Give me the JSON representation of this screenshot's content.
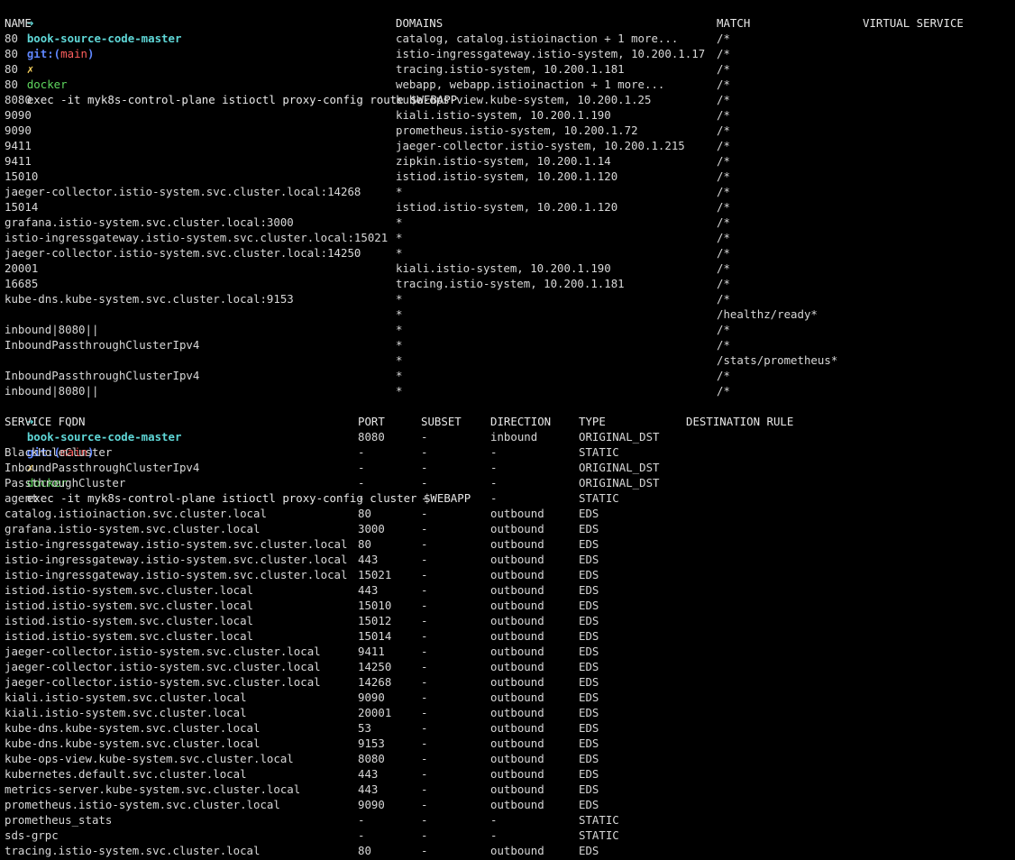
{
  "colors": {
    "background": "#000000",
    "text": "#d8d8d8",
    "prompt_cyan": "#5fd7d7",
    "git_blue": "#5f87ff",
    "branch_red": "#ff5f5f",
    "dirty_yellow": "#ffd75f",
    "command_green": "#5fd75f"
  },
  "prompt": {
    "arrow": "➜",
    "dir": "book-source-code-master",
    "git_label": "git:(",
    "branch": "main",
    "git_close": ")",
    "dirty": "✗"
  },
  "route_cmd": {
    "name": "docker",
    "args": "exec -it myk8s-control-plane istioctl proxy-config route $WEBAPP"
  },
  "route_table": {
    "headers": [
      "NAME",
      "DOMAINS",
      "MATCH",
      "VIRTUAL SERVICE"
    ],
    "rows": [
      [
        "80",
        "catalog, catalog.istioinaction + 1 more...",
        "/*",
        ""
      ],
      [
        "80",
        "istio-ingressgateway.istio-system, 10.200.1.17",
        "/*",
        ""
      ],
      [
        "80",
        "tracing.istio-system, 10.200.1.181",
        "/*",
        ""
      ],
      [
        "80",
        "webapp, webapp.istioinaction + 1 more...",
        "/*",
        ""
      ],
      [
        "8080",
        "kube-ops-view.kube-system, 10.200.1.25",
        "/*",
        ""
      ],
      [
        "9090",
        "kiali.istio-system, 10.200.1.190",
        "/*",
        ""
      ],
      [
        "9090",
        "prometheus.istio-system, 10.200.1.72",
        "/*",
        ""
      ],
      [
        "9411",
        "jaeger-collector.istio-system, 10.200.1.215",
        "/*",
        ""
      ],
      [
        "9411",
        "zipkin.istio-system, 10.200.1.14",
        "/*",
        ""
      ],
      [
        "15010",
        "istiod.istio-system, 10.200.1.120",
        "/*",
        ""
      ],
      [
        "jaeger-collector.istio-system.svc.cluster.local:14268",
        "*",
        "/*",
        ""
      ],
      [
        "15014",
        "istiod.istio-system, 10.200.1.120",
        "/*",
        ""
      ],
      [
        "grafana.istio-system.svc.cluster.local:3000",
        "*",
        "/*",
        ""
      ],
      [
        "istio-ingressgateway.istio-system.svc.cluster.local:15021",
        "*",
        "/*",
        ""
      ],
      [
        "jaeger-collector.istio-system.svc.cluster.local:14250",
        "*",
        "/*",
        ""
      ],
      [
        "20001",
        "kiali.istio-system, 10.200.1.190",
        "/*",
        ""
      ],
      [
        "16685",
        "tracing.istio-system, 10.200.1.181",
        "/*",
        ""
      ],
      [
        "kube-dns.kube-system.svc.cluster.local:9153",
        "*",
        "/*",
        ""
      ],
      [
        "",
        "*",
        "/healthz/ready*",
        ""
      ],
      [
        "inbound|8080||",
        "*",
        "/*",
        ""
      ],
      [
        "InboundPassthroughClusterIpv4",
        "*",
        "/*",
        ""
      ],
      [
        "",
        "*",
        "/stats/prometheus*",
        ""
      ],
      [
        "InboundPassthroughClusterIpv4",
        "*",
        "/*",
        ""
      ],
      [
        "inbound|8080||",
        "*",
        "/*",
        ""
      ]
    ]
  },
  "cluster_cmd": {
    "name": "docker",
    "args": "exec -it myk8s-control-plane istioctl proxy-config cluster $WEBAPP"
  },
  "cluster_table": {
    "headers": [
      "SERVICE FQDN",
      "PORT",
      "SUBSET",
      "DIRECTION",
      "TYPE",
      "DESTINATION RULE"
    ],
    "rows": [
      [
        "",
        "8080",
        "-",
        "inbound",
        "ORIGINAL_DST",
        ""
      ],
      [
        "BlackHoleCluster",
        "-",
        "-",
        "-",
        "STATIC",
        ""
      ],
      [
        "InboundPassthroughClusterIpv4",
        "-",
        "-",
        "-",
        "ORIGINAL_DST",
        ""
      ],
      [
        "PassthroughCluster",
        "-",
        "-",
        "-",
        "ORIGINAL_DST",
        ""
      ],
      [
        "agent",
        "-",
        "-",
        "-",
        "STATIC",
        ""
      ],
      [
        "catalog.istioinaction.svc.cluster.local",
        "80",
        "-",
        "outbound",
        "EDS",
        ""
      ],
      [
        "grafana.istio-system.svc.cluster.local",
        "3000",
        "-",
        "outbound",
        "EDS",
        ""
      ],
      [
        "istio-ingressgateway.istio-system.svc.cluster.local",
        "80",
        "-",
        "outbound",
        "EDS",
        ""
      ],
      [
        "istio-ingressgateway.istio-system.svc.cluster.local",
        "443",
        "-",
        "outbound",
        "EDS",
        ""
      ],
      [
        "istio-ingressgateway.istio-system.svc.cluster.local",
        "15021",
        "-",
        "outbound",
        "EDS",
        ""
      ],
      [
        "istiod.istio-system.svc.cluster.local",
        "443",
        "-",
        "outbound",
        "EDS",
        ""
      ],
      [
        "istiod.istio-system.svc.cluster.local",
        "15010",
        "-",
        "outbound",
        "EDS",
        ""
      ],
      [
        "istiod.istio-system.svc.cluster.local",
        "15012",
        "-",
        "outbound",
        "EDS",
        ""
      ],
      [
        "istiod.istio-system.svc.cluster.local",
        "15014",
        "-",
        "outbound",
        "EDS",
        ""
      ],
      [
        "jaeger-collector.istio-system.svc.cluster.local",
        "9411",
        "-",
        "outbound",
        "EDS",
        ""
      ],
      [
        "jaeger-collector.istio-system.svc.cluster.local",
        "14250",
        "-",
        "outbound",
        "EDS",
        ""
      ],
      [
        "jaeger-collector.istio-system.svc.cluster.local",
        "14268",
        "-",
        "outbound",
        "EDS",
        ""
      ],
      [
        "kiali.istio-system.svc.cluster.local",
        "9090",
        "-",
        "outbound",
        "EDS",
        ""
      ],
      [
        "kiali.istio-system.svc.cluster.local",
        "20001",
        "-",
        "outbound",
        "EDS",
        ""
      ],
      [
        "kube-dns.kube-system.svc.cluster.local",
        "53",
        "-",
        "outbound",
        "EDS",
        ""
      ],
      [
        "kube-dns.kube-system.svc.cluster.local",
        "9153",
        "-",
        "outbound",
        "EDS",
        ""
      ],
      [
        "kube-ops-view.kube-system.svc.cluster.local",
        "8080",
        "-",
        "outbound",
        "EDS",
        ""
      ],
      [
        "kubernetes.default.svc.cluster.local",
        "443",
        "-",
        "outbound",
        "EDS",
        ""
      ],
      [
        "metrics-server.kube-system.svc.cluster.local",
        "443",
        "-",
        "outbound",
        "EDS",
        ""
      ],
      [
        "prometheus.istio-system.svc.cluster.local",
        "9090",
        "-",
        "outbound",
        "EDS",
        ""
      ],
      [
        "prometheus_stats",
        "-",
        "-",
        "-",
        "STATIC",
        ""
      ],
      [
        "sds-grpc",
        "-",
        "-",
        "-",
        "STATIC",
        ""
      ],
      [
        "tracing.istio-system.svc.cluster.local",
        "80",
        "-",
        "outbound",
        "EDS",
        ""
      ]
    ]
  }
}
